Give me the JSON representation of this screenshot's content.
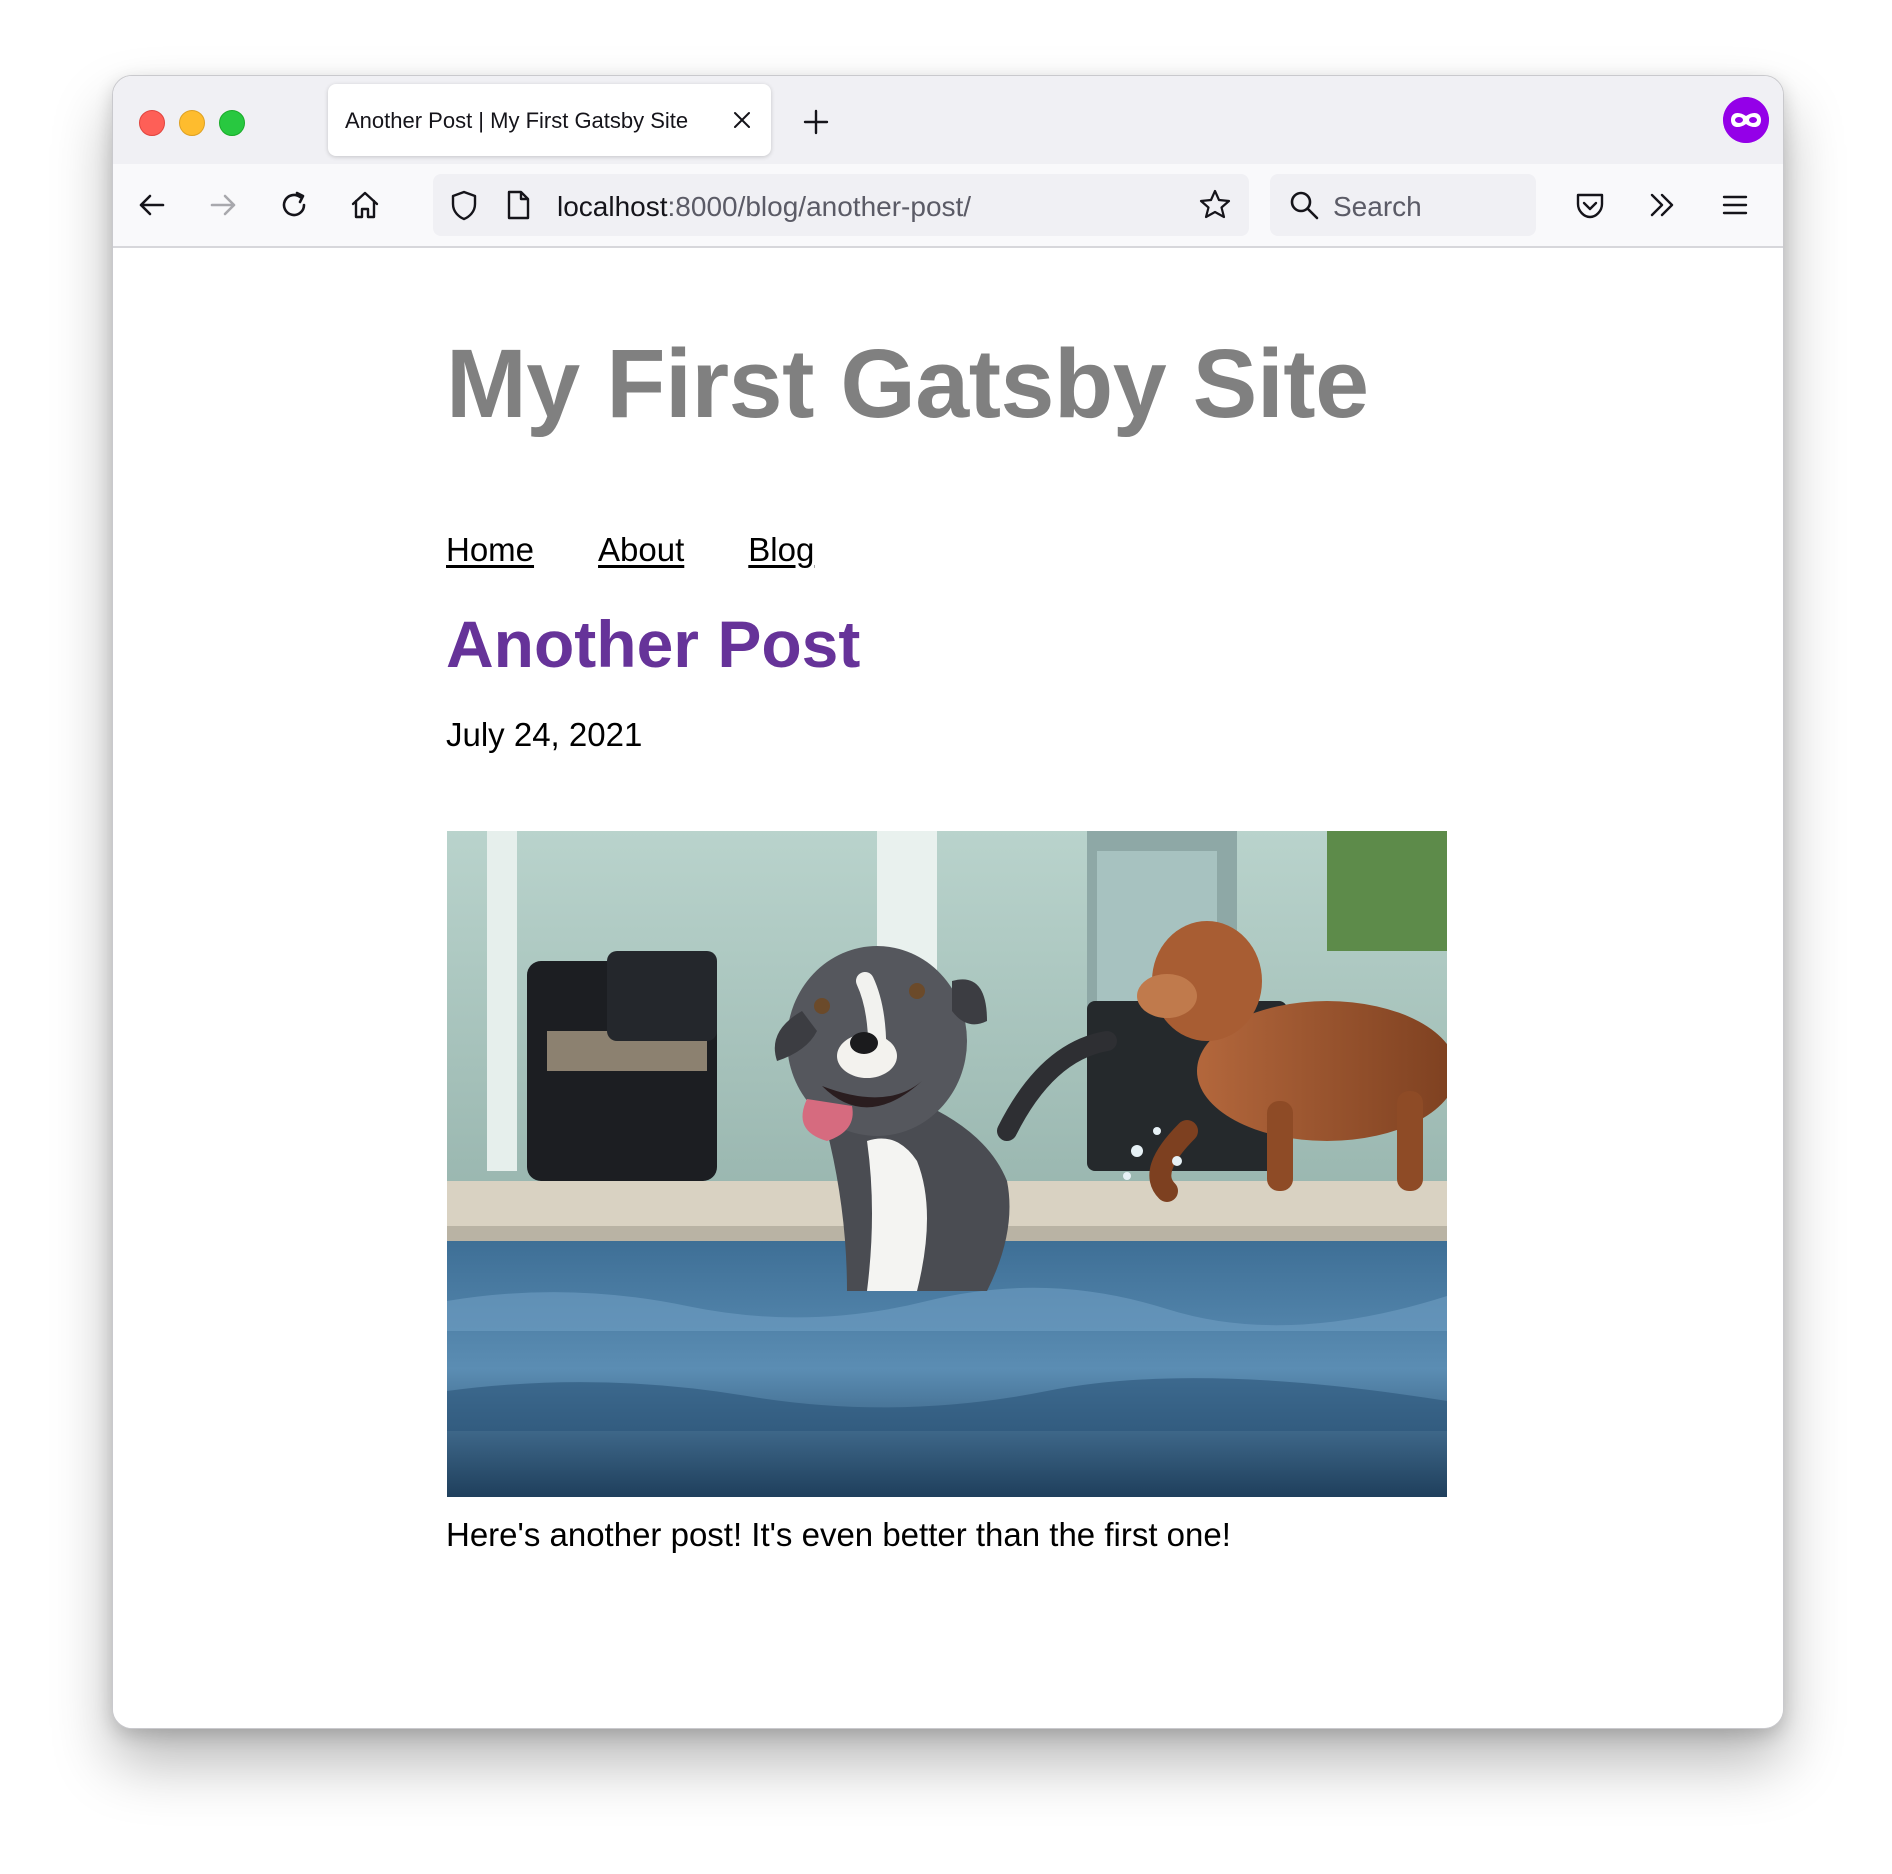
{
  "browser": {
    "tab": {
      "title": "Another Post | My First Gatsby Site"
    },
    "url": {
      "host": "localhost",
      "rest": ":8000/blog/another-post/"
    },
    "search": {
      "placeholder": "Search"
    }
  },
  "page": {
    "site_title": "My First Gatsby Site",
    "nav": [
      {
        "label": "Home"
      },
      {
        "label": "About"
      },
      {
        "label": "Blog"
      }
    ],
    "post": {
      "title": "Another Post",
      "date": "July 24, 2021",
      "body": "Here's another post! It's even better than the first one!",
      "image": {
        "subject": "dog-in-pool-photo"
      }
    },
    "colors": {
      "site_title": "#808080",
      "post_title": "#663399",
      "link": "#000000",
      "profile": "#9400e8"
    }
  }
}
